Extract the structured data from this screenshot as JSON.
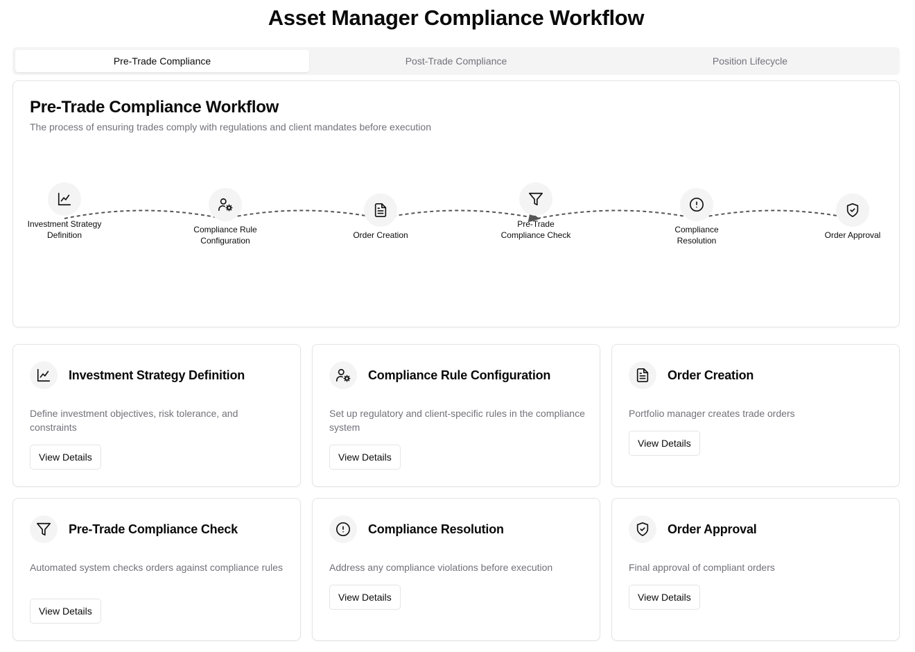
{
  "page": {
    "title": "Asset Manager Compliance Workflow"
  },
  "tabs": [
    {
      "label": "Pre-Trade Compliance",
      "active": true
    },
    {
      "label": "Post-Trade Compliance",
      "active": false
    },
    {
      "label": "Position Lifecycle",
      "active": false
    }
  ],
  "workflow": {
    "title": "Pre-Trade Compliance Workflow",
    "description": "The process of ensuring trades comply with regulations and client mandates before execution",
    "steps": [
      {
        "label": "Investment Strategy Definition",
        "icon": "chart-line-icon"
      },
      {
        "label": "Compliance Rule Configuration",
        "icon": "user-cog-icon"
      },
      {
        "label": "Order Creation",
        "icon": "file-text-icon"
      },
      {
        "label": "Pre-Trade Compliance Check",
        "icon": "filter-icon"
      },
      {
        "label": "Compliance Resolution",
        "icon": "alert-circle-icon"
      },
      {
        "label": "Order Approval",
        "icon": "shield-check-icon"
      }
    ]
  },
  "cards": [
    {
      "title": "Investment Strategy Definition",
      "description": "Define investment objectives, risk tolerance, and constraints",
      "button": "View Details",
      "icon": "chart-line-icon"
    },
    {
      "title": "Compliance Rule Configuration",
      "description": "Set up regulatory and client-specific rules in the compliance system",
      "button": "View Details",
      "icon": "user-cog-icon"
    },
    {
      "title": "Order Creation",
      "description": "Portfolio manager creates trade orders",
      "button": "View Details",
      "icon": "file-text-icon"
    },
    {
      "title": "Pre-Trade Compliance Check",
      "description": "Automated system checks orders against compliance rules",
      "button": "View Details",
      "icon": "filter-icon"
    },
    {
      "title": "Compliance Resolution",
      "description": "Address any compliance violations before execution",
      "button": "View Details",
      "icon": "alert-circle-icon"
    },
    {
      "title": "Order Approval",
      "description": "Final approval of compliant orders",
      "button": "View Details",
      "icon": "shield-check-icon"
    }
  ]
}
